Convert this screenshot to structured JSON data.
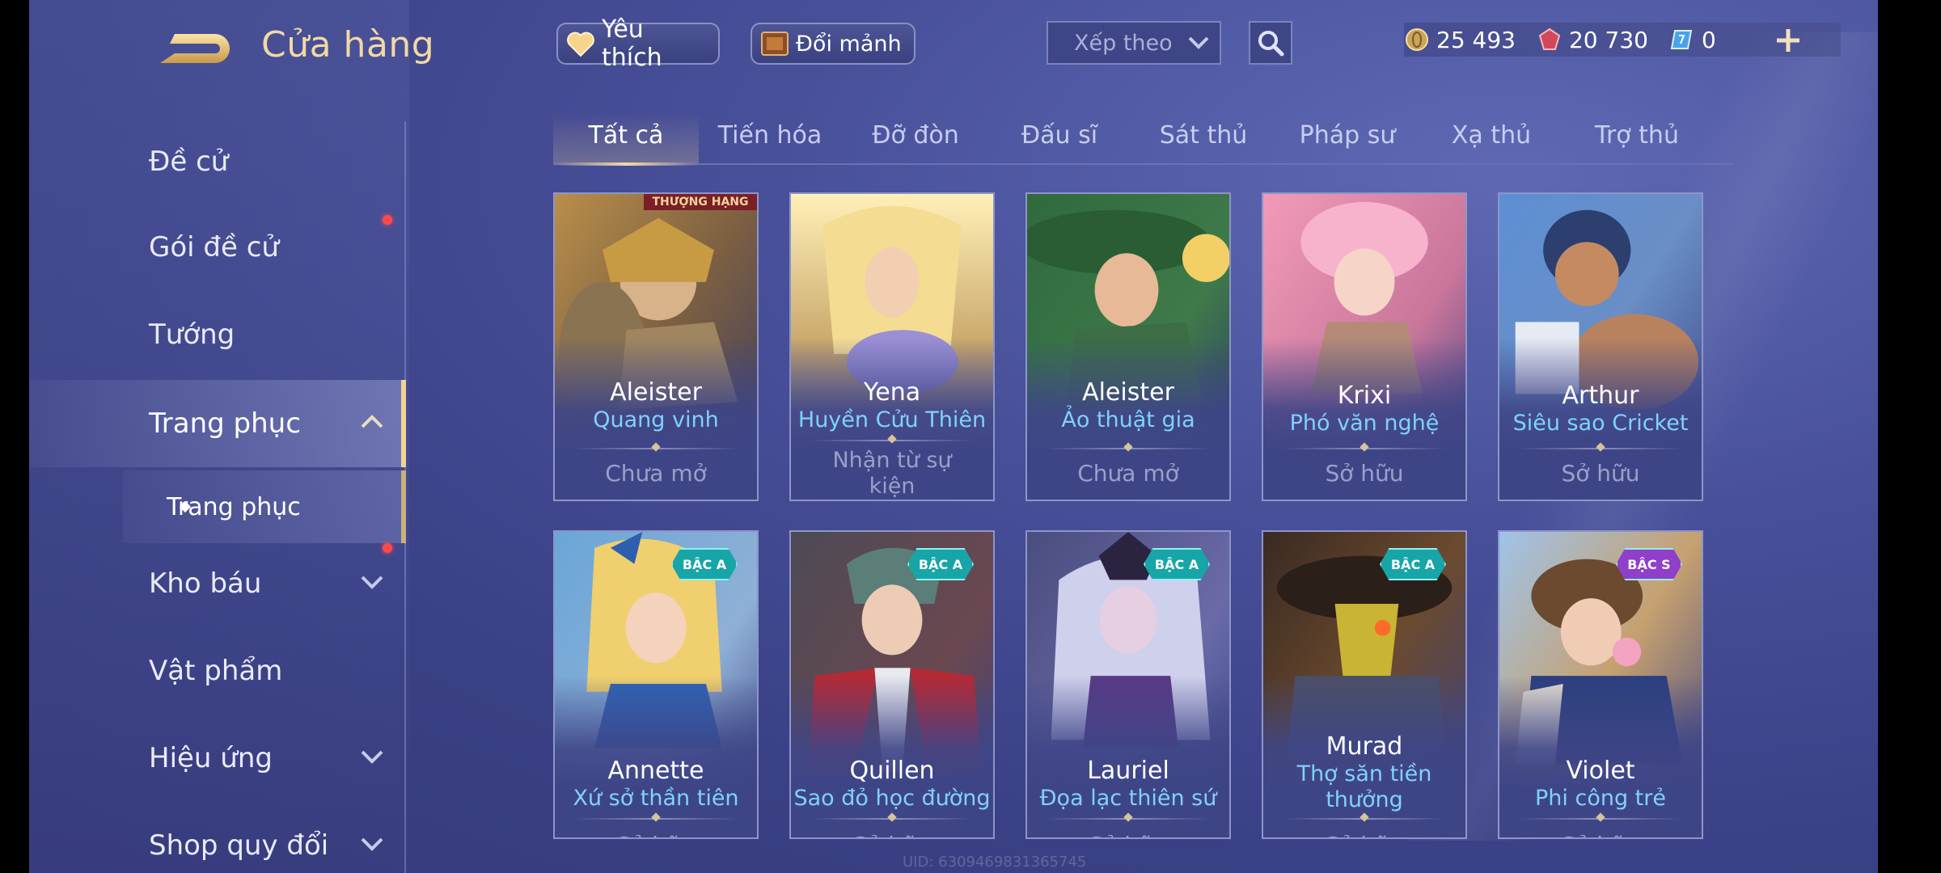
{
  "header": {
    "title": "Cửa hàng",
    "favorite_label": "Yêu thích",
    "exchange_label": "Đổi mảnh",
    "sort_placeholder": "Xếp theo"
  },
  "currencies": [
    {
      "icon": "gold-coin-icon",
      "value": "25 493"
    },
    {
      "icon": "ruby-gem-icon",
      "value": "20 730"
    },
    {
      "icon": "voucher-icon",
      "value": "0"
    }
  ],
  "sidebar": {
    "items": [
      {
        "label": "Đề cử"
      },
      {
        "label": "Gói đề cử",
        "dot": true
      },
      {
        "label": "Tướng"
      },
      {
        "label": "Trang phục",
        "active": true,
        "expanded": true
      },
      {
        "label": "Kho báu",
        "dot": true,
        "collapsible": true
      },
      {
        "label": "Vật phẩm"
      },
      {
        "label": "Hiệu ứng",
        "collapsible": true
      },
      {
        "label": "Shop quy đổi",
        "collapsible": true
      }
    ],
    "sub_item": "Trang phục"
  },
  "tabs": [
    "Tất cả",
    "Tiến hóa",
    "Đỡ đòn",
    "Đấu sĩ",
    "Sát thủ",
    "Pháp sư",
    "Xạ thủ",
    "Trợ thủ"
  ],
  "active_tab": 0,
  "cards": [
    {
      "hero": "Aleister",
      "skin": "Quang vinh",
      "status": "Chưa mở",
      "badge": "THƯỢNG HẠNG"
    },
    {
      "hero": "Yena",
      "skin": "Huyền Cửu Thiên",
      "status": "Nhận từ sự kiện"
    },
    {
      "hero": "Aleister",
      "skin": "Ảo thuật gia",
      "status": "Chưa mở"
    },
    {
      "hero": "Krixi",
      "skin": "Phó văn nghệ",
      "status": "Sở hữu"
    },
    {
      "hero": "Arthur",
      "skin": "Siêu sao Cricket",
      "status": "Sở hữu"
    },
    {
      "hero": "Annette",
      "skin": "Xứ sở thần tiên",
      "status": "Sở hữu",
      "tier": "BẬC A"
    },
    {
      "hero": "Quillen",
      "skin": "Sao đỏ học đường",
      "status": "Sở hữu",
      "tier": "BẬC A"
    },
    {
      "hero": "Lauriel",
      "skin": "Đọa lạc thiên sứ",
      "status": "Sở hữu",
      "tier": "BẬC A"
    },
    {
      "hero": "Murad",
      "skin": "Thợ săn tiền thưởng",
      "status": "Sở hữu",
      "tier": "BẬC A"
    },
    {
      "hero": "Violet",
      "skin": "Phi công trẻ",
      "status": "Sở hữu",
      "tier": "BẬC S"
    }
  ],
  "uid_text": "UID: 6309469831365745",
  "colors": {
    "accent_gold": "#f1d9a5",
    "skin_name_blue": "#7fd1ff",
    "notification_red": "#ff4a4a",
    "tier_a_teal": "#18a5a8",
    "tier_s_purple": "#8f3fc9"
  }
}
